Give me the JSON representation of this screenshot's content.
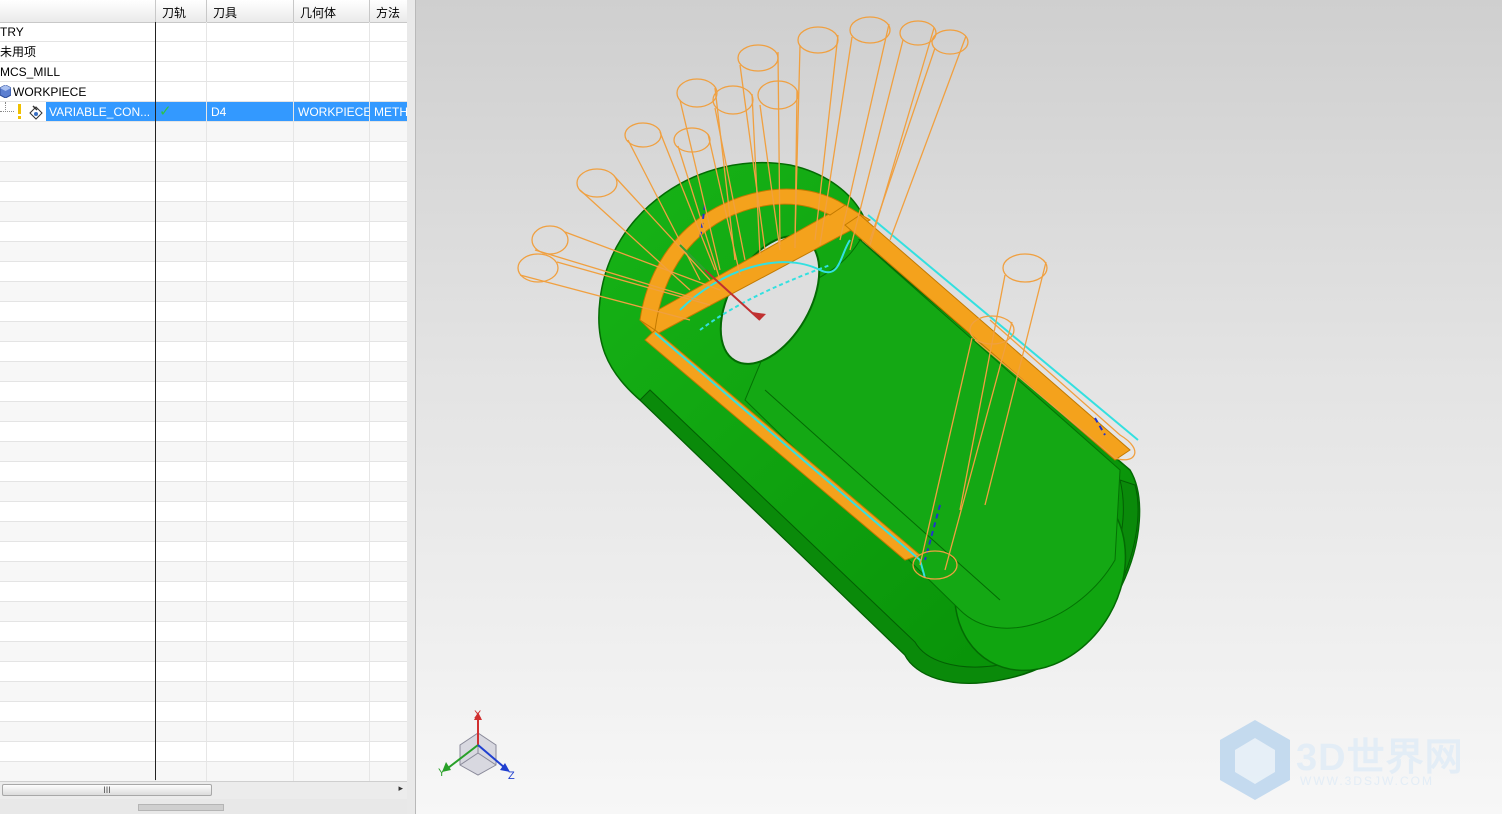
{
  "navigator": {
    "columns": [
      "",
      "刀轨",
      "刀具",
      "几何体",
      "方法"
    ],
    "rows": [
      {
        "name": "TRY",
        "path": "",
        "tool": "",
        "geometry": "",
        "method": ""
      },
      {
        "name": "未用项",
        "path": "",
        "tool": "",
        "geometry": "",
        "method": ""
      },
      {
        "name": "MCS_MILL",
        "path": "",
        "tool": "",
        "geometry": "",
        "method": ""
      },
      {
        "name": "WORKPIECE",
        "path": "",
        "tool": "",
        "geometry": "",
        "method": ""
      },
      {
        "name": "VARIABLE_CON...",
        "path": "✓",
        "tool": "D4",
        "geometry": "WORKPIECE",
        "method": "METH"
      }
    ],
    "scroll_grip": "III",
    "scroll_arrow": "▸"
  },
  "viewport": {
    "triad": {
      "x": "X",
      "y": "Y",
      "z": "Z"
    },
    "watermark": {
      "text": "3D世界网",
      "sub": "WWW.3DSJW.COM"
    },
    "part_color": "#0a9e0a",
    "tool_color": "#f0a040",
    "path_color": "#33e0e0",
    "selection_color": "#3399ff"
  }
}
